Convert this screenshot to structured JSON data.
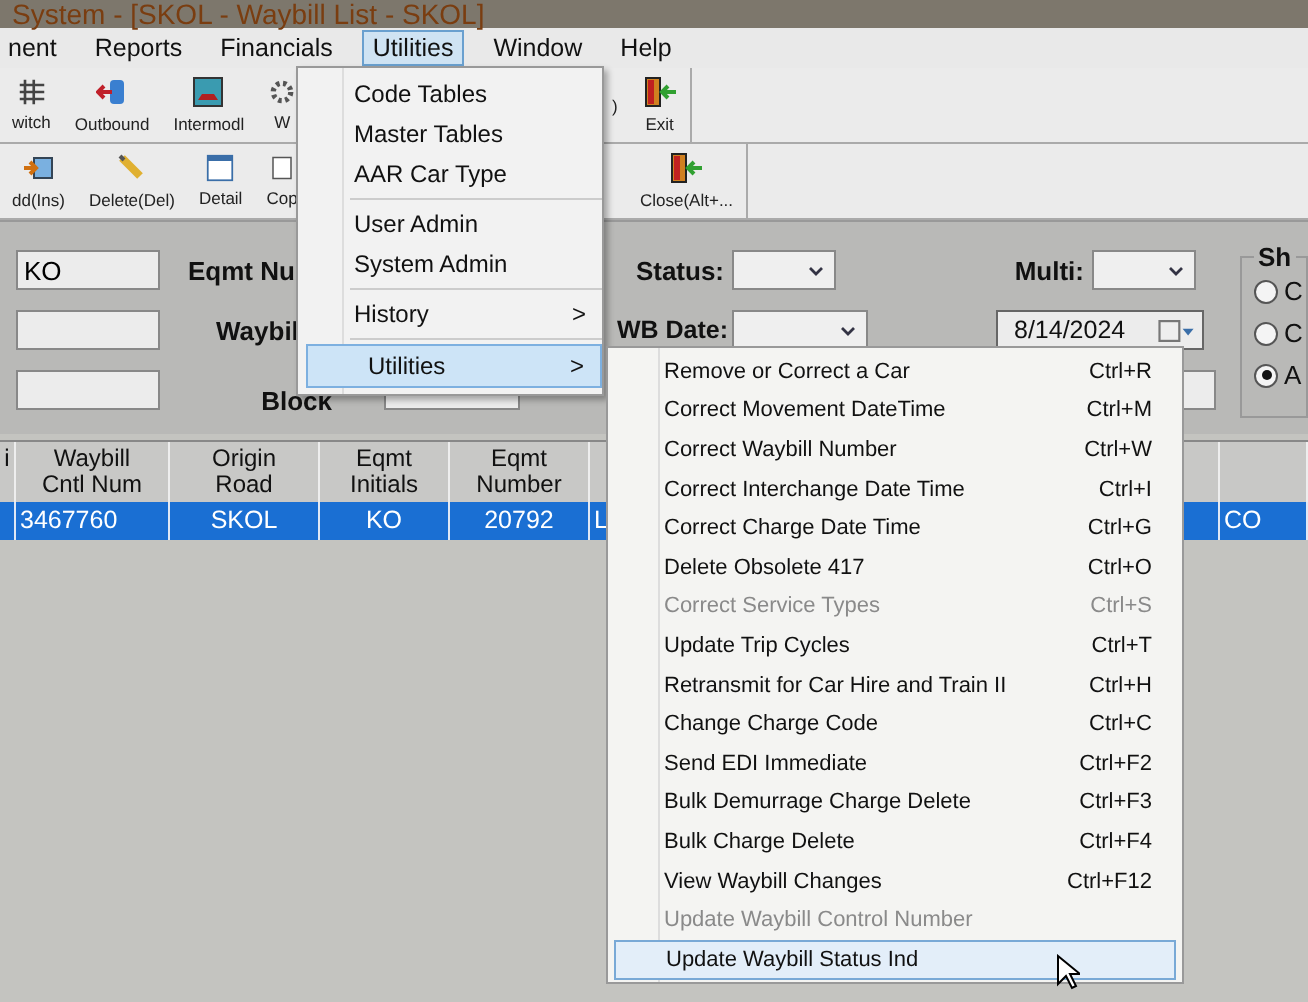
{
  "window": {
    "title": "System - [SKOL - Waybill List - SKOL]"
  },
  "menu_bar": [
    {
      "label": "nent",
      "selected": false
    },
    {
      "label": "Reports",
      "selected": false
    },
    {
      "label": "Financials",
      "selected": false
    },
    {
      "label": "Utilities",
      "selected": true
    },
    {
      "label": "Window",
      "selected": false
    },
    {
      "label": "Help",
      "selected": false
    }
  ],
  "toolbar": {
    "rows": [
      {
        "left": [
          "witch",
          "Outbound",
          "Intermodl",
          "W"
        ],
        "right": [
          ")",
          "Exit"
        ]
      },
      {
        "left": [
          "dd(Ins)",
          "Delete(Del)",
          "Detail",
          "Cop"
        ],
        "right": [
          "Close(Alt+..."
        ]
      }
    ]
  },
  "filters": {
    "initials": "KO",
    "eqmt_label": "Eqmt Nu",
    "waybill_label": "Waybil",
    "block_label": "Block",
    "status_label": "Status:",
    "wb_date_label": "WB Date:",
    "multi_label": "Multi:",
    "date": "8/14/2024",
    "show_group": {
      "title": "Sh",
      "options": [
        {
          "label": "C",
          "selected": false
        },
        {
          "label": "C",
          "selected": false
        },
        {
          "label": "A",
          "selected": true
        }
      ]
    }
  },
  "table": {
    "columns": [
      "i",
      "Waybill\nCntl Num",
      "Origin\nRoad",
      "Eqmt\nInitials",
      "Eqmt\nNumber"
    ],
    "rows": [
      {
        "selected": true,
        "cells": [
          "",
          "3467760",
          "SKOL",
          "KO",
          "20792",
          "L",
          "CO"
        ]
      }
    ]
  },
  "utilities_menu": [
    {
      "kind": "item",
      "label": "Code Tables"
    },
    {
      "kind": "item",
      "label": "Master Tables"
    },
    {
      "kind": "item",
      "label": "AAR Car Type"
    },
    {
      "kind": "separator"
    },
    {
      "kind": "item",
      "label": "User Admin"
    },
    {
      "kind": "item",
      "label": "System Admin"
    },
    {
      "kind": "separator"
    },
    {
      "kind": "submenu",
      "label": "History",
      "arrow": ">",
      "selected": false
    },
    {
      "kind": "separator"
    },
    {
      "kind": "submenu",
      "label": "Utilities",
      "arrow": ">",
      "selected": true
    }
  ],
  "utilities_submenu": [
    {
      "label": "Remove or Correct a Car",
      "shortcut": "Ctrl+R",
      "disabled": false,
      "selected": false
    },
    {
      "label": "Correct Movement DateTime",
      "shortcut": "Ctrl+M",
      "disabled": false,
      "selected": false
    },
    {
      "label": "Correct Waybill Number",
      "shortcut": "Ctrl+W",
      "disabled": false,
      "selected": false
    },
    {
      "label": "Correct Interchange Date Time",
      "shortcut": "Ctrl+I",
      "disabled": false,
      "selected": false
    },
    {
      "label": "Correct Charge Date Time",
      "shortcut": "Ctrl+G",
      "disabled": false,
      "selected": false
    },
    {
      "label": "Delete Obsolete 417",
      "shortcut": "Ctrl+O",
      "disabled": false,
      "selected": false
    },
    {
      "label": "Correct Service Types",
      "shortcut": "Ctrl+S",
      "disabled": true,
      "selected": false
    },
    {
      "label": "Update Trip Cycles",
      "shortcut": "Ctrl+T",
      "disabled": false,
      "selected": false
    },
    {
      "label": "Retransmit for Car Hire and Train II",
      "shortcut": "Ctrl+H",
      "disabled": false,
      "selected": false
    },
    {
      "label": "Change Charge Code",
      "shortcut": "Ctrl+C",
      "disabled": false,
      "selected": false
    },
    {
      "label": "Send EDI Immediate",
      "shortcut": "Ctrl+F2",
      "disabled": false,
      "selected": false
    },
    {
      "label": "Bulk Demurrage Charge Delete",
      "shortcut": "Ctrl+F3",
      "disabled": false,
      "selected": false
    },
    {
      "label": "Bulk Charge Delete",
      "shortcut": "Ctrl+F4",
      "disabled": false,
      "selected": false
    },
    {
      "label": "View Waybill Changes",
      "shortcut": "Ctrl+F12",
      "disabled": false,
      "selected": false
    },
    {
      "label": "Update Waybill Control Number",
      "disabled": true,
      "selected": false
    },
    {
      "label": "Update Waybill Status Ind",
      "disabled": false,
      "selected": true
    }
  ]
}
